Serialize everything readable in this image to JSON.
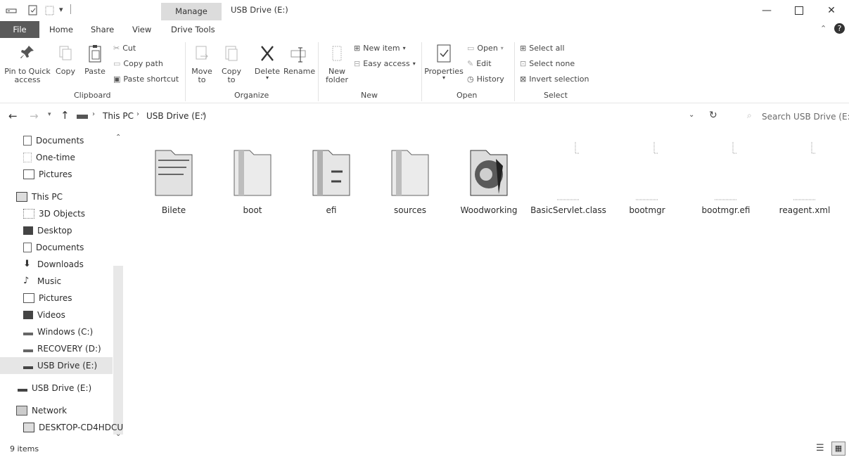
{
  "titlebar": {
    "manage_label": "Manage",
    "title": "USB Drive (E:)",
    "qat_icons": [
      "drive-icon",
      "properties-icon",
      "new-folder-icon",
      "customize-icon"
    ]
  },
  "ribbon_tabs": {
    "file": "File",
    "home": "Home",
    "share": "Share",
    "view": "View",
    "drive_tools": "Drive Tools"
  },
  "ribbon": {
    "clipboard": {
      "group": "Clipboard",
      "pin_line1": "Pin to Quick",
      "pin_line2": "access",
      "copy": "Copy",
      "paste": "Paste",
      "cut": "Cut",
      "copy_path": "Copy path",
      "paste_shortcut": "Paste shortcut"
    },
    "organize": {
      "group": "Organize",
      "move_line1": "Move",
      "move_line2": "to",
      "copy_line1": "Copy",
      "copy_line2": "to",
      "delete": "Delete",
      "rename": "Rename"
    },
    "new": {
      "group": "New",
      "new_folder_line1": "New",
      "new_folder_line2": "folder",
      "new_item": "New item",
      "easy_access": "Easy access"
    },
    "open": {
      "group": "Open",
      "properties": "Properties",
      "open": "Open",
      "edit": "Edit",
      "history": "History"
    },
    "select": {
      "group": "Select",
      "select_all": "Select all",
      "select_none": "Select none",
      "invert_selection": "Invert selection"
    }
  },
  "address": {
    "crumbs": [
      "This PC",
      "USB Drive (E:)"
    ],
    "search_placeholder": "Search USB Drive (E:)"
  },
  "nav": {
    "items": [
      {
        "label": "Documents",
        "icon": "documents-icon"
      },
      {
        "label": "One-time",
        "icon": "folder-icon"
      },
      {
        "label": "Pictures",
        "icon": "pictures-icon"
      },
      {
        "label": "This PC",
        "icon": "computer-icon"
      },
      {
        "label": "3D Objects",
        "icon": "3d-objects-icon"
      },
      {
        "label": "Desktop",
        "icon": "desktop-icon"
      },
      {
        "label": "Documents",
        "icon": "documents-icon"
      },
      {
        "label": "Downloads",
        "icon": "downloads-icon"
      },
      {
        "label": "Music",
        "icon": "music-icon"
      },
      {
        "label": "Pictures",
        "icon": "pictures-icon"
      },
      {
        "label": "Videos",
        "icon": "videos-icon"
      },
      {
        "label": "Windows (C:)",
        "icon": "drive-icon"
      },
      {
        "label": "RECOVERY (D:)",
        "icon": "drive-icon"
      },
      {
        "label": "USB Drive (E:)",
        "icon": "usb-drive-icon"
      },
      {
        "label": "USB Drive (E:)",
        "icon": "usb-drive-icon"
      },
      {
        "label": "Network",
        "icon": "network-icon"
      },
      {
        "label": "DESKTOP-CD4HDCU",
        "icon": "computer-icon"
      }
    ]
  },
  "files": [
    {
      "name": "Bilete",
      "icon": "folder-icon"
    },
    {
      "name": "boot",
      "icon": "folder-icon"
    },
    {
      "name": "efi",
      "icon": "folder-icon"
    },
    {
      "name": "sources",
      "icon": "folder-icon"
    },
    {
      "name": "Woodworking",
      "icon": "folder-icon"
    },
    {
      "name": "BasicServlet.class",
      "icon": "file-icon"
    },
    {
      "name": "bootmgr",
      "icon": "file-icon"
    },
    {
      "name": "bootmgr.efi",
      "icon": "file-icon"
    },
    {
      "name": "reagent.xml",
      "icon": "file-icon"
    }
  ],
  "status": {
    "count": "9 items"
  },
  "colors": {
    "file_tab_bg": "#5a5a5a",
    "manage_bg": "#dcdcdc",
    "selected_bg": "#e6e6e6"
  }
}
